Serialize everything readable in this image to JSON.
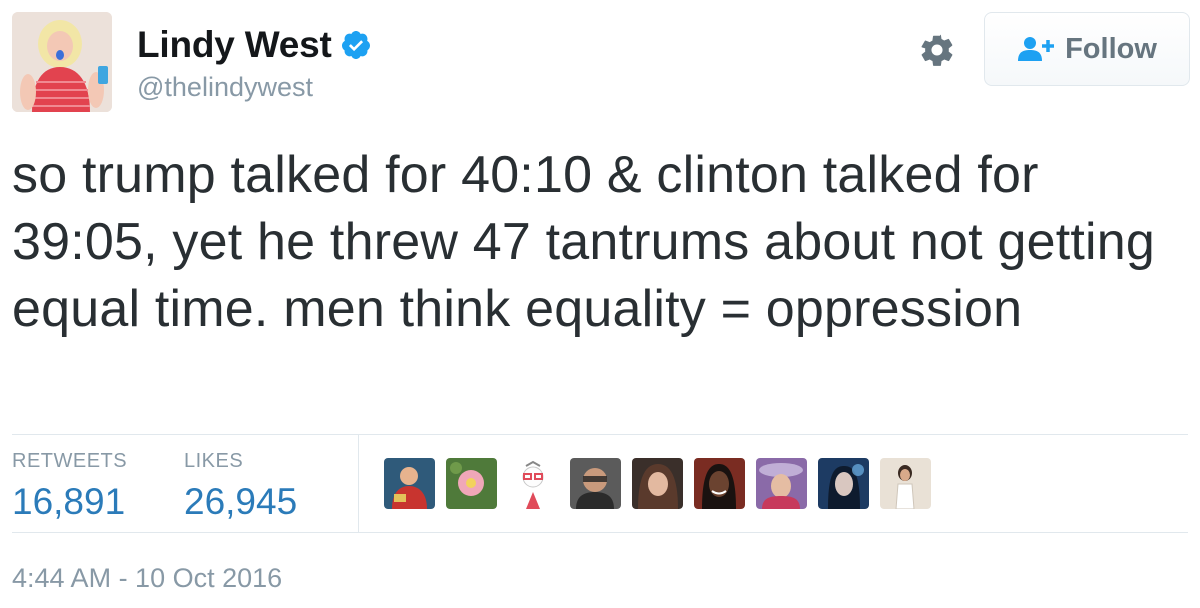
{
  "author": {
    "display_name": "Lindy West",
    "handle": "@thelindywest",
    "verified": true,
    "avatar_icon": "profile-photo"
  },
  "actions": {
    "settings_icon": "gear-icon",
    "follow_label": "Follow",
    "follow_icon": "add-person-icon"
  },
  "tweet": {
    "text": "so trump talked for 40:10 & clinton talked for 39:05, yet he threw 47 tantrums about not getting equal time. men think equality = oppression"
  },
  "stats": {
    "retweets_label": "RETWEETS",
    "retweets_value": "16,891",
    "likes_label": "LIKES",
    "likes_value": "26,945"
  },
  "likers": [
    {
      "icon": "liker-avatar-1"
    },
    {
      "icon": "liker-avatar-2"
    },
    {
      "icon": "liker-avatar-3"
    },
    {
      "icon": "liker-avatar-4"
    },
    {
      "icon": "liker-avatar-5"
    },
    {
      "icon": "liker-avatar-6"
    },
    {
      "icon": "liker-avatar-7"
    },
    {
      "icon": "liker-avatar-8"
    },
    {
      "icon": "liker-avatar-9"
    }
  ],
  "timestamp": "4:44 AM - 10 Oct 2016",
  "colors": {
    "link_blue": "#2b7bb9",
    "verified_blue": "#1da1f2",
    "secondary_text": "#8899a6",
    "primary_text": "#292f33"
  }
}
